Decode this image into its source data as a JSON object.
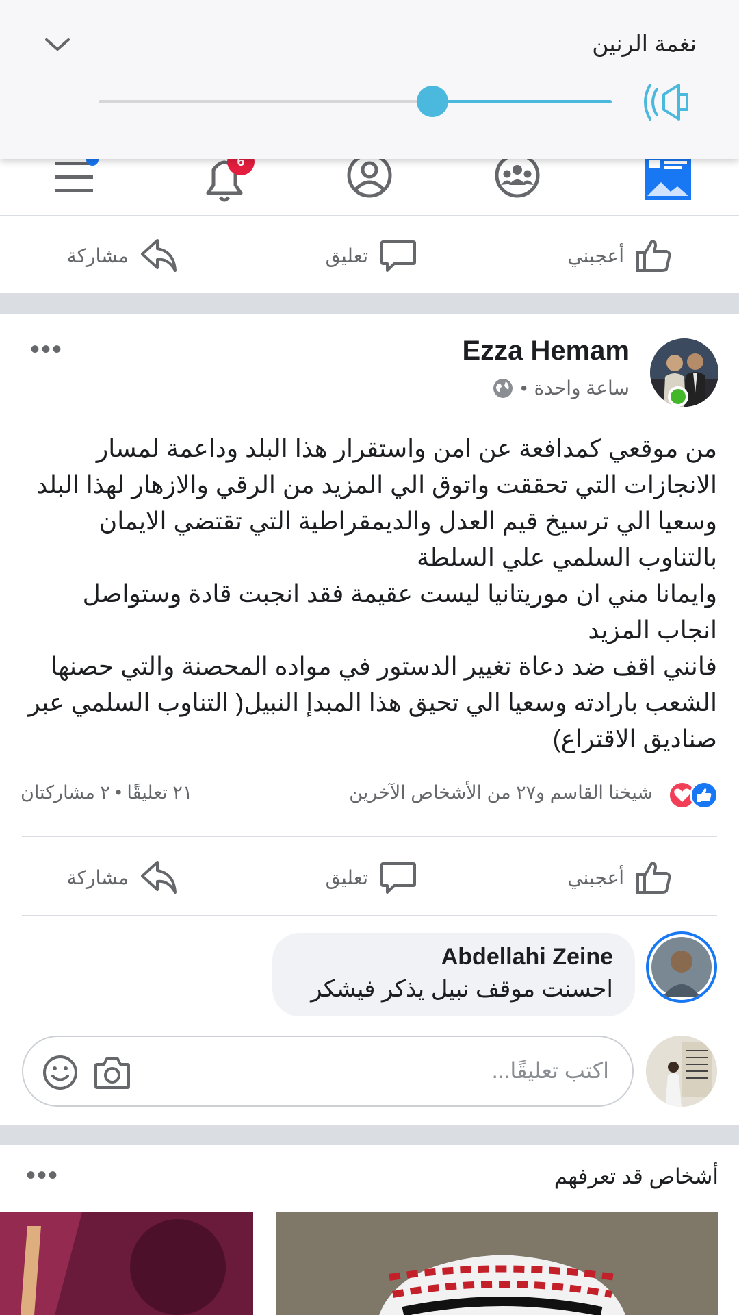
{
  "volume_panel": {
    "title": "نغمة الرنين",
    "level": 0.35,
    "accent_color": "#4bb8de",
    "speaker_icon": "speaker-icon",
    "collapse_icon": "chevron-down-icon"
  },
  "nav": {
    "items": [
      "news-feed-icon",
      "groups-icon",
      "profile-icon",
      "notifications-icon",
      "menu-icon"
    ],
    "notifications_badge": "6"
  },
  "top_actions": {
    "like": "أعجبني",
    "comment": "تعليق",
    "share": "مشاركة"
  },
  "post": {
    "author": "Ezza Hemam",
    "time": "ساعة واحدة",
    "meta_separator": "•",
    "privacy_icon": "globe-icon",
    "more": "•••",
    "text": "من موقعي كمدافعة عن امن واستقرار هذا البلد وداعمة لمسار\nالانجازات التي تحققت واتوق الي المزيد من الرقي والازهار لهذا البلد\nوسعيا الي ترسيخ قيم العدل والديمقراطية التي تقتضي الايمان\nبالتناوب السلمي علي السلطة\nوايمانا مني ان موريتانيا ليست عقيمة فقد انجبت قادة وستواصل\nانجاب المزيد\nفانني اقف ضد دعاة تغيير الدستور في مواده المحصنة والتي حصنها\nالشعب بارادته وسعيا الي تحيق هذا المبدإ النبيل( التناوب السلمي عبر\nصناديق الاقتراع)",
    "reactions_text": "شيخنا القاسم و٢٧ من الأشخاص الآخرين",
    "counts_text": "٢١ تعليقًا • ٢ مشاركتان",
    "actions": {
      "like": "أعجبني",
      "comment": "تعليق",
      "share": "مشاركة"
    }
  },
  "comment": {
    "author": "Abdellahi Zeine",
    "text": "احسنت موقف نبيل يذكر فيشكر"
  },
  "comment_input": {
    "placeholder": "اكتب تعليقًا..."
  },
  "pymk": {
    "title": "أشخاص قد تعرفهم",
    "more": "•••"
  },
  "colors": {
    "facebook_blue": "#1877f2",
    "love_red": "#f33e58",
    "online_green": "#42b72a",
    "badge_red": "#e41e3f"
  }
}
